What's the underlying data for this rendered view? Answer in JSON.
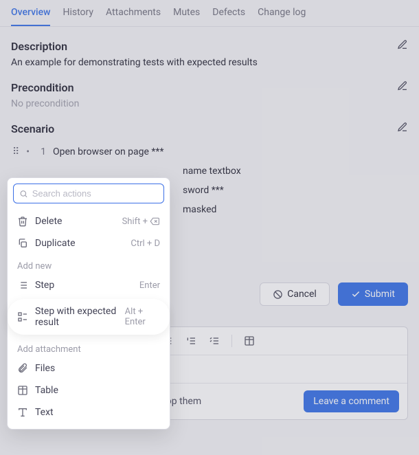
{
  "tabs": [
    "Overview",
    "History",
    "Attachments",
    "Mutes",
    "Defects",
    "Change log"
  ],
  "description": {
    "title": "Description",
    "body": "An example for demonstrating tests with expected results"
  },
  "precondition": {
    "title": "Precondition",
    "body": "No precondition"
  },
  "scenario": {
    "title": "Scenario",
    "rows": [
      {
        "num": "1",
        "text": "Open browser on page ***"
      },
      {
        "num": "",
        "text": "name textbox"
      },
      {
        "num": "",
        "text": "sword ***"
      },
      {
        "num": "",
        "text": "masked"
      }
    ]
  },
  "buttons": {
    "cancel": "Cancel",
    "submit": "Submit"
  },
  "comment": {
    "placeholder": "Leave a comment",
    "attach_text": "Attach files or drag & drop them",
    "leave_label": "Leave a comment"
  },
  "dropdown": {
    "search_placeholder": "Search actions",
    "items": [
      {
        "label": "Delete",
        "shortcut": "Shift + ",
        "has_backspace_icon": true,
        "icon": "trash"
      },
      {
        "label": "Duplicate",
        "shortcut": "Ctrl + D",
        "icon": "copy"
      }
    ],
    "add_new_header": "Add new",
    "add_new": [
      {
        "label": "Step",
        "shortcut": "Enter",
        "icon": "step"
      },
      {
        "label": "Step with expected result",
        "shortcut": "Alt + Enter",
        "icon": "step-result",
        "highlight": true
      }
    ],
    "attach_header": "Add attachment",
    "attach": [
      {
        "label": "Files",
        "icon": "clip"
      },
      {
        "label": "Table",
        "icon": "table"
      },
      {
        "label": "Text",
        "icon": "text"
      }
    ]
  }
}
